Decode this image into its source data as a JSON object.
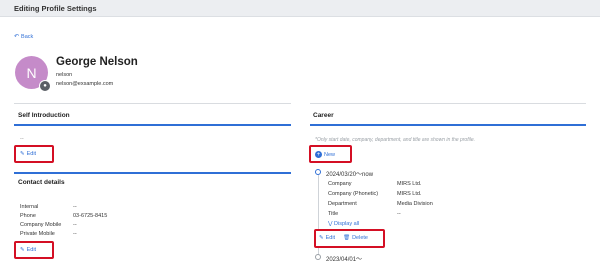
{
  "header": {
    "title": "Editing Profile Settings"
  },
  "back": {
    "label": "Back"
  },
  "profile": {
    "initial": "N",
    "name": "George Nelson",
    "username": "nelson",
    "email": "nelson@exsample.com"
  },
  "self_intro": {
    "heading": "Self Introduction",
    "value": "--",
    "edit_label": "Edit"
  },
  "contact": {
    "heading": "Contact details",
    "rows": [
      {
        "label": "Internal",
        "value": "--"
      },
      {
        "label": "Phone",
        "value": "03-6725-8415"
      },
      {
        "label": "Company Mobile",
        "value": "--"
      },
      {
        "label": "Private Mobile",
        "value": "--"
      }
    ],
    "edit_label": "Edit"
  },
  "career": {
    "heading": "Career",
    "hint": "*Only start date, company, department, and title are shown in the profile.",
    "new_label": "New",
    "entries": [
      {
        "date": "2024/03/20～now",
        "fields": [
          {
            "label": "Company",
            "value": "MIRS Ltd."
          },
          {
            "label": "Company (Phonetic)",
            "value": "MIRS Ltd."
          },
          {
            "label": "Department",
            "value": "Media Division"
          },
          {
            "label": "Title",
            "value": "--"
          }
        ],
        "display_all": "Display all",
        "edit_label": "Edit",
        "delete_label": "Delete"
      },
      {
        "date": "2023/04/01～"
      }
    ]
  },
  "colors": {
    "accent": "#2f6fd6",
    "highlight_box": "#d40f24",
    "avatar": "#c58bc9"
  }
}
